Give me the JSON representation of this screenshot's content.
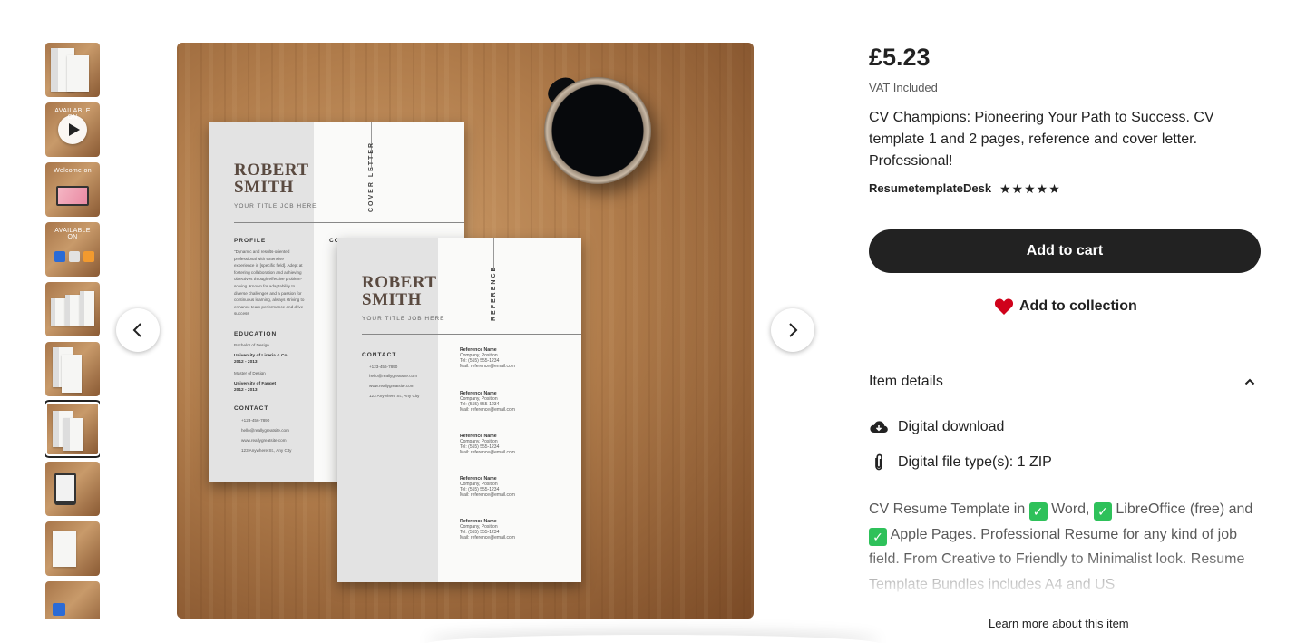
{
  "gallery": {
    "thumbnails": [
      {
        "label": ""
      },
      {
        "label": "AVAILABLE ON"
      },
      {
        "label": "Welcome on"
      },
      {
        "label": "AVAILABLE ON"
      },
      {
        "label": ""
      },
      {
        "label": ""
      },
      {
        "label": ""
      },
      {
        "label": ""
      },
      {
        "label": ""
      },
      {
        "label": ""
      }
    ],
    "selected_index": 6,
    "prev_icon": "chevron-left-icon",
    "next_icon": "chevron-right-icon",
    "main": {
      "cover_letter": {
        "first_name": "ROBERT",
        "last_name": "SMITH",
        "job_title": "YOUR TITLE JOB HERE",
        "vertical_title": "COVER LETTER",
        "profile_heading": "PROFILE",
        "profile_text": "\"Dynamic and results-oriented professional with extensive experience in [specific field]. Adept at fostering collaboration and achieving objectives through effective problem-solving. Known for adaptability to diverse challenges and a passion for continuous learning, always striving to enhance team performance and drive success",
        "education_heading": "EDUCATION",
        "edu1_degree": "Bachelor of Design",
        "edu1_school": "University of Liceria & Co.",
        "edu1_years": "2012 - 2013",
        "edu2_degree": "Master of Design",
        "edu2_school": "University of Fauget",
        "edu2_years": "2012 - 2013",
        "contact_heading": "CONTACT",
        "phone": "+123-456-7890",
        "email": "hello@reallygreatsite.com",
        "website": "www.reallygreatsite.com",
        "address": "123 Anywhere St., Any City",
        "partial_heading": "CO"
      },
      "reference": {
        "first_name": "ROBERT",
        "last_name": "SMITH",
        "job_title": "YOUR TITLE JOB HERE",
        "vertical_title": "REFERENCE",
        "contact_heading": "CONTACT",
        "phone": "+123-456-7890",
        "email": "hello@reallygreatsite.com",
        "website": "www.reallygreatsite.com",
        "address": "123 Anywhere St., Any City",
        "entries": [
          {
            "name": "Reference Name",
            "company": "Company,  Position",
            "tel": "Tel: (555) 555-1234",
            "mail": "Mail: reference@email.com"
          },
          {
            "name": "Reference Name",
            "company": "Company,  Position",
            "tel": "Tel: (555) 555-1234",
            "mail": "Mail: reference@email.com"
          },
          {
            "name": "Reference Name",
            "company": "Company,  Position",
            "tel": "Tel: (555) 555-1234",
            "mail": "Mail: reference@email.com"
          },
          {
            "name": "Reference Name",
            "company": "Company,  Position",
            "tel": "Tel: (555) 555-1234",
            "mail": "Mail: reference@email.com"
          },
          {
            "name": "Reference Name",
            "company": "Company,  Position",
            "tel": "Tel: (555) 555-1234",
            "mail": "Mail: reference@email.com"
          }
        ]
      }
    }
  },
  "listing": {
    "price": "£5.23",
    "vat": "VAT Included",
    "title": "CV Champions: Pioneering Your Path to Success. CV template 1 and 2 pages, reference and cover letter. Professional!",
    "shop_name": "ResumetemplateDesk",
    "stars": "★★★★★",
    "rating": 5,
    "add_to_cart": "Add to cart",
    "add_to_collection": "Add to collection",
    "item_details": "Item details",
    "digital_download": "Digital download",
    "file_types": "Digital file type(s): 1 ZIP",
    "desc_parts": {
      "p1": "CV Resume Template in ",
      "p2": " Word, ",
      "p3": " LibreOffice (free) and ",
      "p4": " Apple Pages. Professional Resume for any kind of job field. From Creative to Friendly to Minimalist look. Resume Template Bundles includes A4 and US"
    },
    "check_mark": "✓",
    "learn_more": "Learn more about this item"
  },
  "colors": {
    "button": "#222222",
    "heart": "#d0021b",
    "check": "#2ec15a"
  }
}
